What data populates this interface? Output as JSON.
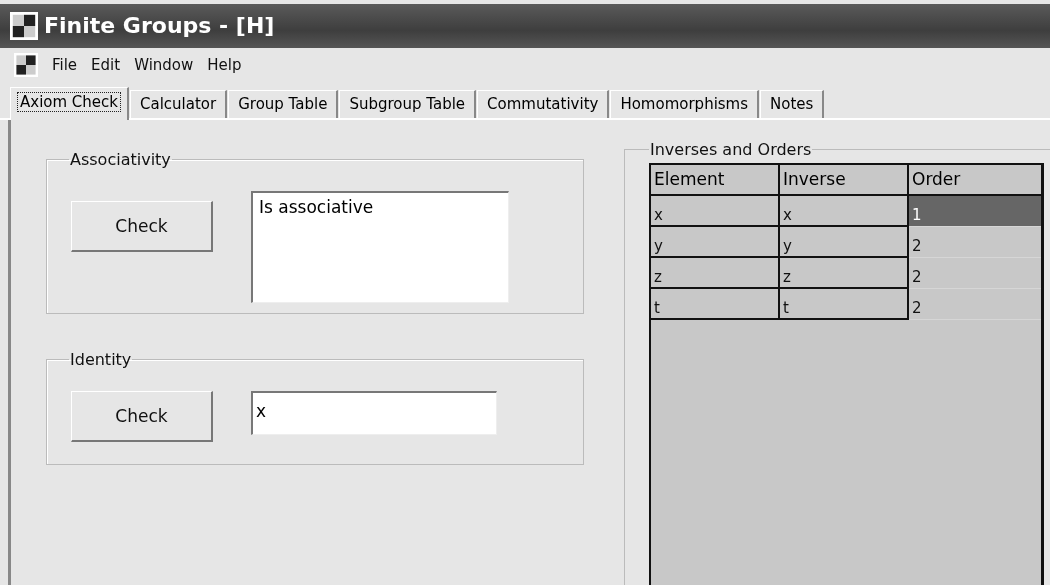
{
  "window": {
    "title": "Finite Groups - [H]"
  },
  "menu": [
    "File",
    "Edit",
    "Window",
    "Help"
  ],
  "tabs": [
    {
      "label": "Axiom Check",
      "selected": true
    },
    {
      "label": "Calculator",
      "selected": false
    },
    {
      "label": "Group Table",
      "selected": false
    },
    {
      "label": "Subgroup Table",
      "selected": false
    },
    {
      "label": "Commutativity",
      "selected": false
    },
    {
      "label": "Homomorphisms",
      "selected": false
    },
    {
      "label": "Notes",
      "selected": false
    }
  ],
  "associativity": {
    "title": "Associativity",
    "button": "Check",
    "result": "Is associative"
  },
  "identity": {
    "title": "Identity",
    "button": "Check",
    "result": "x"
  },
  "inverses": {
    "title": "Inverses and Orders",
    "columns": [
      "Element",
      "Inverse",
      "Order"
    ],
    "rows": [
      {
        "cells": [
          "x",
          "x",
          "1"
        ],
        "selected": true
      },
      {
        "cells": [
          "y",
          "y",
          "2"
        ],
        "selected": false
      },
      {
        "cells": [
          "z",
          "z",
          "2"
        ],
        "selected": false
      },
      {
        "cells": [
          "t",
          "t",
          "2"
        ],
        "selected": false
      }
    ]
  }
}
